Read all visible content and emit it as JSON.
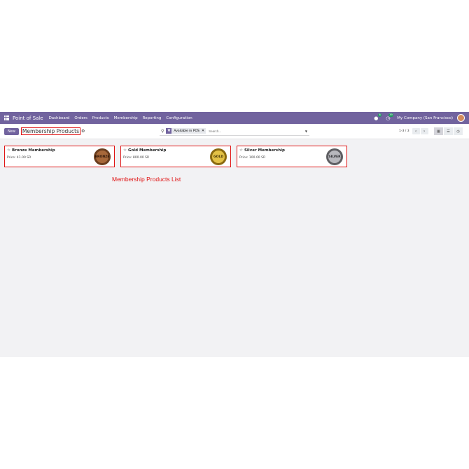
{
  "navbar": {
    "brand": "Point of Sale",
    "menu": [
      "Dashboard",
      "Orders",
      "Products",
      "Membership",
      "Reporting",
      "Configuration"
    ],
    "chat_badge": "8",
    "activity_badge": "39",
    "company": "My Company (San Francisco)",
    "bg_color": "#71639e"
  },
  "control": {
    "new_label": "New",
    "breadcrumb": "Membership Products",
    "search": {
      "facet": "Available in POS",
      "placeholder": "Search..."
    },
    "pager": "1-3 / 3"
  },
  "cards": [
    {
      "title": "Bronze Membership",
      "price": "Price: 41.00 SR",
      "medal": "BRONZE",
      "medal_color": "#a7683a"
    },
    {
      "title": "Gold Membership",
      "price": "Price: 800.00 SR",
      "medal": "GOLD",
      "medal_color": "#c9a227"
    },
    {
      "title": "Silver Membership",
      "price": "Price: 100.00 SR",
      "medal": "SILVER",
      "medal_color": "#9a9a9e"
    }
  ],
  "annotation": "Membership Products List",
  "icons": {
    "apps": "apps-grid-icon",
    "chat": "chat-icon",
    "activity": "clock-icon",
    "search": "search-icon",
    "filter": "filter-icon",
    "star": "star-icon",
    "kanban": "kanban-view-icon",
    "list": "list-view-icon",
    "settings": "gear-icon"
  }
}
